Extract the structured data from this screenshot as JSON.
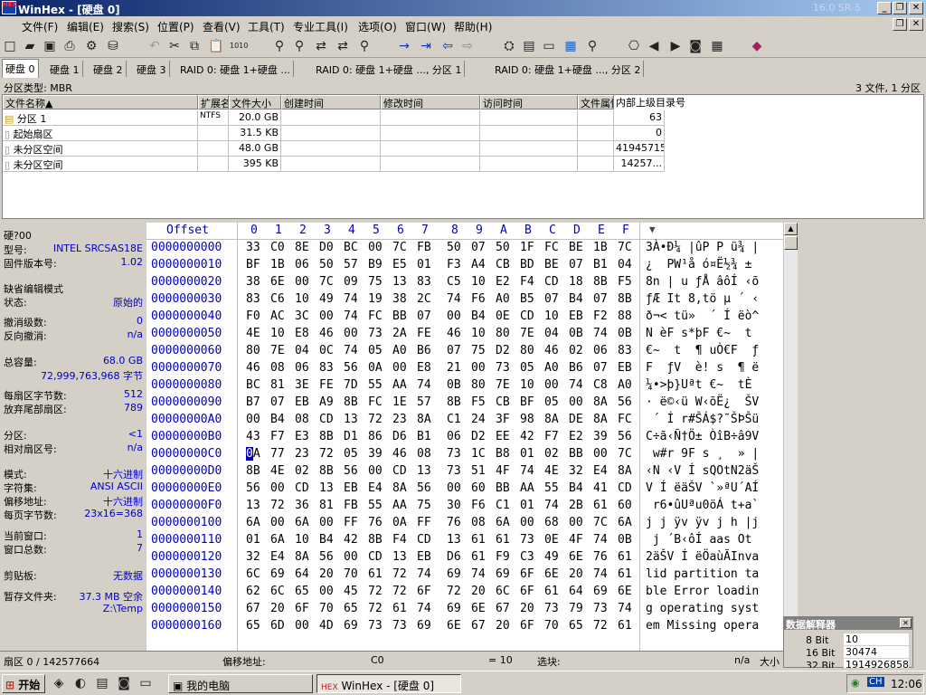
{
  "window": {
    "title": "WinHex - [硬盘 0]",
    "version": "16.0 SR-5"
  },
  "menu": [
    "文件(F)",
    "编辑(E)",
    "搜索(S)",
    "位置(P)",
    "查看(V)",
    "工具(T)",
    "专业工具(I)",
    "选项(O)",
    "窗口(W)",
    "帮助(H)"
  ],
  "tabs": [
    "硬盘 0",
    "硬盘 1",
    "硬盘 2",
    "硬盘 3",
    "RAID 0: 硬盘 1+硬盘 ...",
    "RAID 0: 硬盘 1+硬盘 ..., 分区 1",
    "RAID 0: 硬盘 1+硬盘 ..., 分区 2"
  ],
  "partinfo": {
    "label": "分区类型: MBR",
    "count": "3 文件, 1 分区"
  },
  "filelist": {
    "headers": [
      "文件名称▲",
      "扩展名",
      "文件大小",
      "创建时间",
      "修改时间",
      "访问时间",
      "文件属性",
      "内部上级目录号"
    ],
    "rows": [
      {
        "name": "分区 1",
        "ext": "NTFS",
        "size": "20.0 GB",
        "id": "63"
      },
      {
        "name": "起始扇区",
        "ext": "",
        "size": "31.5 KB",
        "id": "0"
      },
      {
        "name": "未分区空间",
        "ext": "",
        "size": "48.0 GB",
        "id": "41945715"
      },
      {
        "name": "未分区空间",
        "ext": "",
        "size": "395 KB",
        "id": "14257..."
      }
    ]
  },
  "left": {
    "disk": "硬?00",
    "items": [
      {
        "k": "型号:",
        "v": "INTEL  SRCSAS18E"
      },
      {
        "k": "固件版本号:",
        "v": "1.02"
      },
      {
        "k": "缺省编辑模式",
        "v": ""
      },
      {
        "k": "状态:",
        "v": "原始的"
      },
      {
        "k": "撤消级数:",
        "v": "0"
      },
      {
        "k": "反向撤消:",
        "v": "n/a"
      },
      {
        "k": "总容量:",
        "v": "68.0 GB"
      },
      {
        "k": "",
        "v": "72,999,763,968 字节"
      },
      {
        "k": "每扇区字节数:",
        "v": "512"
      },
      {
        "k": "放弃尾部扇区:",
        "v": "789"
      },
      {
        "k": "分区:",
        "v": "<1"
      },
      {
        "k": "相对扇区号:",
        "v": "n/a"
      },
      {
        "k": "模式:",
        "v": "十六进制"
      },
      {
        "k": "字符集:",
        "v": "ANSI ASCII"
      },
      {
        "k": "偏移地址:",
        "v": "十六进制"
      },
      {
        "k": "每页字节数:",
        "v": "23x16=368"
      },
      {
        "k": "当前窗口:",
        "v": "1"
      },
      {
        "k": "窗口总数:",
        "v": "7"
      },
      {
        "k": "剪贴板:",
        "v": "无数据"
      },
      {
        "k": "暂存文件夹:",
        "v": "37.3 MB 空余"
      },
      {
        "k": "",
        "v": "Z:\\Temp"
      }
    ]
  },
  "hex": {
    "header_offset": "Offset",
    "cols": [
      "0",
      "1",
      "2",
      "3",
      "4",
      "5",
      "6",
      "7",
      "8",
      "9",
      "A",
      "B",
      "C",
      "D",
      "E",
      "F"
    ],
    "rows": [
      {
        "o": "0000000000",
        "b": "33 C0 8E D0 BC 00 7C FB 50 07 50 1F FC BE 1B 7C",
        "a": "3À•Ð¼ |ûP P ü¾ |"
      },
      {
        "o": "0000000010",
        "b": "BF 1B 06 50 57 B9 E5 01 F3 A4 CB BD BE 07 B1 04",
        "a": "¿  PW¹å ó¤Ë½¾ ±"
      },
      {
        "o": "0000000020",
        "b": "38 6E 00 7C 09 75 13 83 C5 10 E2 F4 CD 18 8B F5",
        "a": "8n | u ƒÅ âôÍ ‹õ"
      },
      {
        "o": "0000000030",
        "b": "83 C6 10 49 74 19 38 2C 74 F6 A0 B5 07 B4 07 8B",
        "a": "ƒÆ It 8,tö µ ´ ‹"
      },
      {
        "o": "0000000040",
        "b": "F0 AC 3C 00 74 FC BB 07 00 B4 0E CD 10 EB F2 88",
        "a": "ð¬< tü»  ´ Í ëò^"
      },
      {
        "o": "0000000050",
        "b": "4E 10 E8 46 00 73 2A FE 46 10 80 7E 04 0B 74 0B",
        "a": "N èF s*þF €~  t"
      },
      {
        "o": "0000000060",
        "b": "80 7E 04 0C 74 05 A0 B6 07 75 D2 80 46 02 06 83",
        "a": "€~  t  ¶ uÒ€F  ƒ"
      },
      {
        "o": "0000000070",
        "b": "46 08 06 83 56 0A 00 E8 21 00 73 05 A0 B6 07 EB",
        "a": "F  ƒV  è! s  ¶ ë"
      },
      {
        "o": "0000000080",
        "b": "BC 81 3E FE 7D 55 AA 74 0B 80 7E 10 00 74 C8 A0",
        "a": "¼•>þ}Uªt €~  tÈ "
      },
      {
        "o": "0000000090",
        "b": "B7 07 EB A9 8B FC 1E 57 8B F5 CB BF 05 00 8A 56",
        "a": "· ë©‹ü W‹õË¿  ŠV"
      },
      {
        "o": "00000000A0",
        "b": "00 B4 08 CD 13 72 23 8A C1 24 3F 98 8A DE 8A FC",
        "a": " ´ Í r#ŠÁ$?˜ŠÞŠü"
      },
      {
        "o": "00000000B0",
        "b": "43 F7 E3 8B D1 86 D6 B1 06 D2 EE 42 F7 E2 39 56",
        "a": "C÷ã‹Ñ†Ö± ÒîB÷â9V"
      },
      {
        "o": "00000000C0",
        "b": "0A 77 23 72 05 39 46 08 73 1C B8 01 02 BB 00 7C",
        "a": " w#r 9F s ¸  » |"
      },
      {
        "o": "00000000D0",
        "b": "8B 4E 02 8B 56 00 CD 13 73 51 4F 74 4E 32 E4 8A",
        "a": "‹N ‹V Í sQOtN2äŠ"
      },
      {
        "o": "00000000E0",
        "b": "56 00 CD 13 EB E4 8A 56 00 60 BB AA 55 B4 41 CD",
        "a": "V Í ëäŠV `»ªU´AÍ"
      },
      {
        "o": "00000000F0",
        "b": "13 72 36 81 FB 55 AA 75 30 F6 C1 01 74 2B 61 60",
        "a": " r6•ûUªu0öÁ t+a`"
      },
      {
        "o": "0000000100",
        "b": "6A 00 6A 00 FF 76 0A FF 76 08 6A 00 68 00 7C 6A",
        "a": "j j ÿv ÿv j h |j"
      },
      {
        "o": "0000000110",
        "b": "01 6A 10 B4 42 8B F4 CD 13 61 61 73 0E 4F 74 0B",
        "a": " j ´B‹ôÍ aas Ot "
      },
      {
        "o": "0000000120",
        "b": "32 E4 8A 56 00 CD 13 EB D6 61 F9 C3 49 6E 76 61",
        "a": "2äŠV Í ëÖaùÃInva"
      },
      {
        "o": "0000000130",
        "b": "6C 69 64 20 70 61 72 74 69 74 69 6F 6E 20 74 61",
        "a": "lid partition ta"
      },
      {
        "o": "0000000140",
        "b": "62 6C 65 00 45 72 72 6F 72 20 6C 6F 61 64 69 6E",
        "a": "ble Error loadin"
      },
      {
        "o": "0000000150",
        "b": "67 20 6F 70 65 72 61 74 69 6E 67 20 73 79 73 74",
        "a": "g operating syst"
      },
      {
        "o": "0000000160",
        "b": "65 6D 00 4D 69 73 73 69 6E 67 20 6F 70 65 72 61",
        "a": "em Missing opera"
      }
    ]
  },
  "status": {
    "sector": "扇区 0 / 142577664",
    "offset_label": "偏移地址:",
    "offset_val": "C0",
    "eq": "= 10",
    "sel_label": "选块:",
    "sel_val": "n/a",
    "size_label": "大小"
  },
  "interp": {
    "title": "数据解释器",
    "r1k": "8 Bit",
    "r1v": "10",
    "r2k": "16 Bit",
    "r2v": "30474",
    "r3k": "32 Bit",
    "r3v": "1914926858"
  },
  "taskbar": {
    "start": "开始",
    "item1": "我的电脑",
    "item2": "WinHex - [硬盘 0]",
    "lang": "CH",
    "time": "12:06"
  }
}
